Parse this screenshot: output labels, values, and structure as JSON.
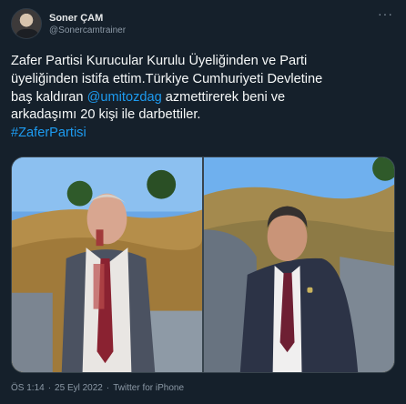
{
  "author": {
    "name": "Soner ÇAM",
    "handle": "@Sonercamtrainer"
  },
  "menu_icon": "more-horizontal-icon",
  "tweet": {
    "line1": "Zafer Partisi Kurucular Kurulu Üyeliğinden ve Parti",
    "line2": "üyeliğinden istifa ettim.Türkiye Cumhuriyeti Devletine",
    "line3_pre": "baş kaldıran ",
    "mention": "@umitozdag",
    "line3_post": " azmettirerek beni ve",
    "line4": "arkadaşımı 20 kişi ile darbettiler.",
    "hashtag": "#ZaferPartisi"
  },
  "media": [
    {
      "alt": "photo-1"
    },
    {
      "alt": "photo-2"
    }
  ],
  "footer": {
    "time": "ÖS 1:14",
    "sep1": "·",
    "date": "25 Eyl 2022",
    "sep2": "·",
    "source": "Twitter for iPhone"
  },
  "colors": {
    "background": "#15202b",
    "link": "#1d9bf0",
    "secondary_text": "#8b98a5"
  }
}
